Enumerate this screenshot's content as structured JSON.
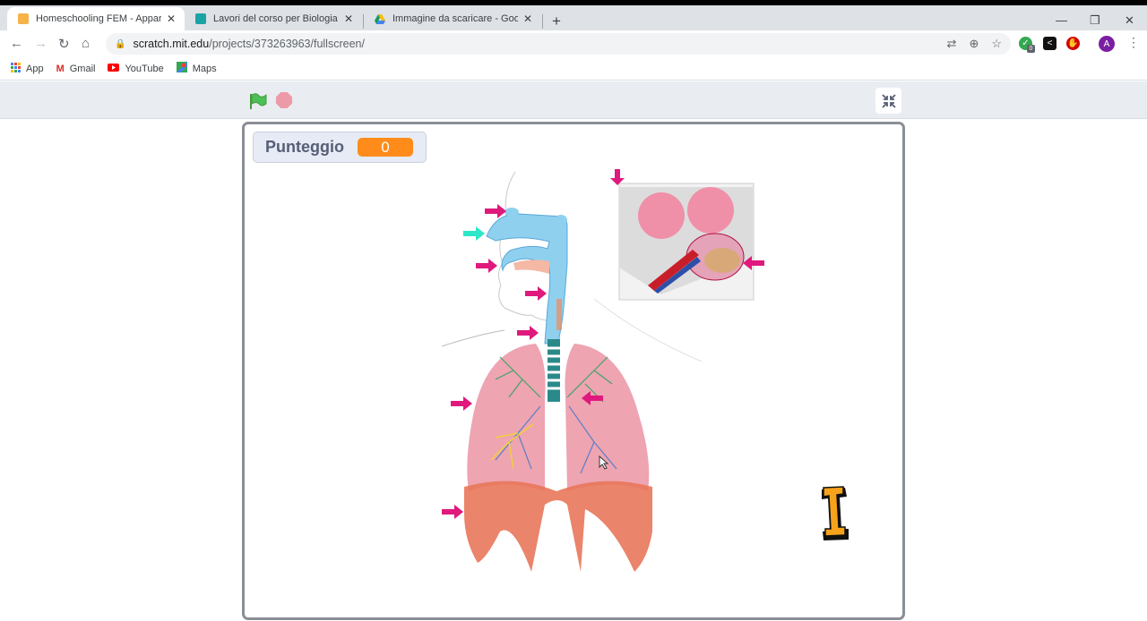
{
  "browser": {
    "tabs": [
      {
        "title": "Homeschooling FEM - Apparato",
        "icon": "scratch-favicon",
        "active": true
      },
      {
        "title": "Lavori del corso per Biologia in u",
        "icon": "classroom-favicon",
        "active": false
      },
      {
        "title": "Immagine da scaricare - Google",
        "icon": "drive-favicon",
        "active": false
      }
    ],
    "new_tab_label": "+",
    "window_controls": {
      "minimize": "—",
      "restore": "❐",
      "close": "✕"
    },
    "address": {
      "host": "scratch.mit.edu",
      "path": "/projects/373263963/fullscreen/"
    },
    "extension_badge": "0",
    "profile_initial": "A",
    "bookmarks": [
      {
        "label": "App",
        "icon": "apps-grid-icon"
      },
      {
        "label": "Gmail",
        "icon": "gmail-icon"
      },
      {
        "label": "YouTube",
        "icon": "youtube-icon"
      },
      {
        "label": "Maps",
        "icon": "maps-icon"
      }
    ]
  },
  "scratch": {
    "controls": {
      "green_flag": "green-flag",
      "stop": "stop"
    },
    "monitor": {
      "label": "Punteggio",
      "value": "0"
    },
    "stage": {
      "sprites": [
        "respiratory-system-diagram",
        "alveoli-inset",
        "letter-I-sprite"
      ],
      "letter_sprite_text": "I"
    },
    "colors": {
      "accent": "#ff8c1a",
      "arrow": "#e0197d",
      "arrow_alt": "#2ee6c8"
    }
  }
}
